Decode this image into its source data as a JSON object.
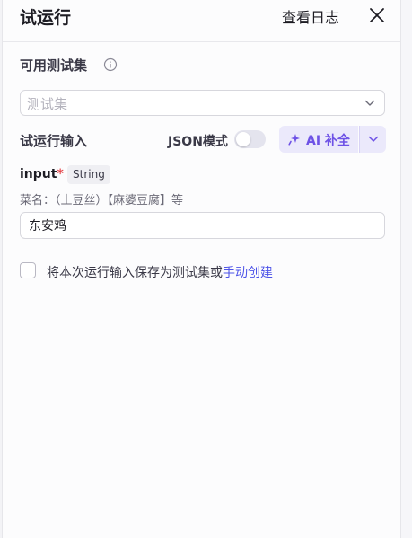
{
  "header": {
    "title": "试运行",
    "view_log": "查看日志",
    "close_icon": "close-icon"
  },
  "test_set": {
    "label": "可用测试集",
    "info_icon": "info-icon",
    "select_placeholder": "测试集"
  },
  "run_input": {
    "label": "试运行输入",
    "json_mode_label": "JSON模式",
    "json_mode_on": false,
    "ai_fill_label": "AI 补全",
    "ai_icon": "sparkle-icon"
  },
  "field": {
    "name": "input",
    "required_mark": "*",
    "type": "String",
    "description": "菜名：（土豆丝）【麻婆豆腐】等",
    "value": "东安鸡"
  },
  "save": {
    "text": "将本次运行输入保存为测试集或",
    "link": "手动创建",
    "checked": false
  },
  "colors": {
    "accent": "#6e52e6",
    "link": "#4d53e8",
    "ai_button_bg": "#ebe9fb",
    "required": "#e5484d"
  }
}
